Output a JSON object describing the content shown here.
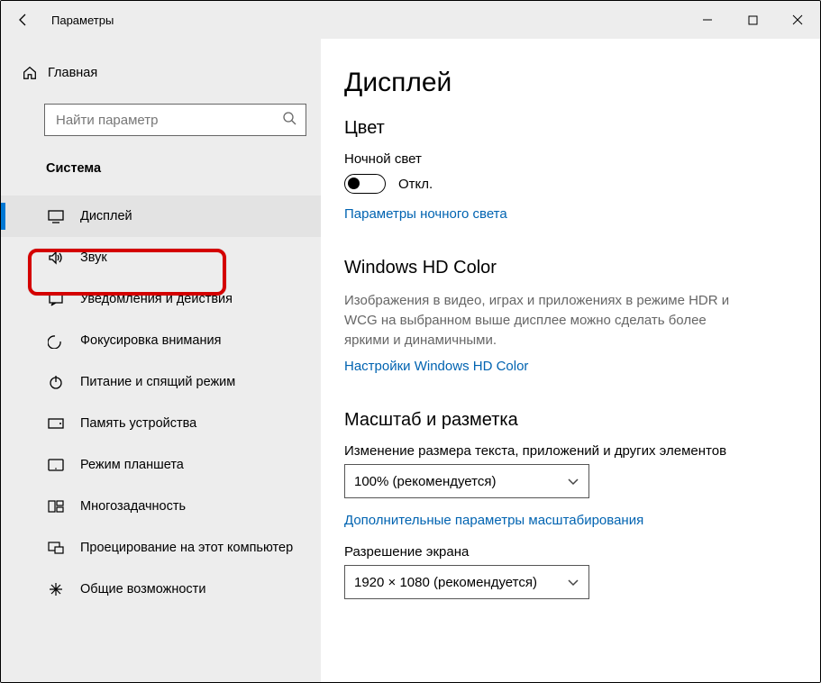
{
  "titlebar": {
    "title": "Параметры"
  },
  "sidebar": {
    "home": "Главная",
    "search_placeholder": "Найти параметр",
    "category": "Система",
    "items": [
      {
        "label": "Дисплей"
      },
      {
        "label": "Звук"
      },
      {
        "label": "Уведомления и действия"
      },
      {
        "label": "Фокусировка внимания"
      },
      {
        "label": "Питание и спящий режим"
      },
      {
        "label": "Память устройства"
      },
      {
        "label": "Режим планшета"
      },
      {
        "label": "Многозадачность"
      },
      {
        "label": "Проецирование на этот компьютер"
      },
      {
        "label": "Общие возможности"
      }
    ]
  },
  "content": {
    "page_title": "Дисплей",
    "color_section": "Цвет",
    "night_light_label": "Ночной свет",
    "toggle_off_label": "Откл.",
    "night_light_link": "Параметры ночного света",
    "hd_section": "Windows HD Color",
    "hd_desc": "Изображения в видео, играх и приложениях в режиме HDR и WCG на выбранном выше дисплее можно сделать более яркими и динамичными.",
    "hd_link": "Настройки Windows HD Color",
    "scale_section": "Масштаб и разметка",
    "scale_label": "Изменение размера текста, приложений и других элементов",
    "scale_value": "100% (рекомендуется)",
    "scale_link": "Дополнительные параметры масштабирования",
    "resolution_label": "Разрешение экрана",
    "resolution_value": "1920 × 1080 (рекомендуется)"
  }
}
